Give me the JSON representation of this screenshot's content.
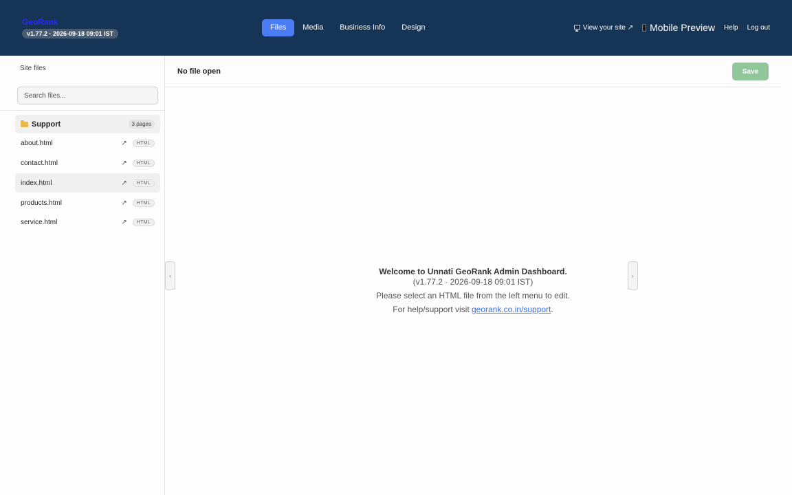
{
  "header": {
    "brand": "GeoRank",
    "version": "v1.77.2 · 2026-09-18 09:01 IST",
    "nav": [
      {
        "label": "Files",
        "active": true
      },
      {
        "label": "Media",
        "active": false
      },
      {
        "label": "Business Info",
        "active": false
      },
      {
        "label": "Design",
        "active": false
      }
    ],
    "view_site": "View your site ↗",
    "mobile_preview": "Mobile Preview",
    "help": "Help",
    "logout": "Log out"
  },
  "sidebar": {
    "heading": "Site files",
    "search_placeholder": "Search files...",
    "folder": {
      "name": "Support",
      "count": "3 pages"
    },
    "files": [
      {
        "name": "about.html",
        "open": "↗",
        "type": "HTML",
        "active": false
      },
      {
        "name": "contact.html",
        "open": "↗",
        "type": "HTML",
        "active": false
      },
      {
        "name": "index.html",
        "open": "↗",
        "type": "HTML",
        "active": true
      },
      {
        "name": "products.html",
        "open": "↗",
        "type": "HTML",
        "active": false
      },
      {
        "name": "service.html",
        "open": "↗",
        "type": "HTML",
        "active": false
      }
    ]
  },
  "main": {
    "no_file": "No file open",
    "save_label": "Save",
    "collapse_left": "‹",
    "collapse_right": "›",
    "welcome": {
      "title": "Welcome to Unnati GeoRank Admin Dashboard.",
      "version": "(v1.77.2 · 2026-09-18 09:01 IST)",
      "instruction": "Please select an HTML file from the left menu to edit.",
      "support_prefix": "For help/support visit ",
      "support_link": "georank.co.in/support",
      "support_suffix": "."
    }
  },
  "colors": {
    "header_bg": "#163556",
    "active_tab": "#4b7cf3",
    "save_button": "#90c79a",
    "link": "#3b6fe0"
  }
}
